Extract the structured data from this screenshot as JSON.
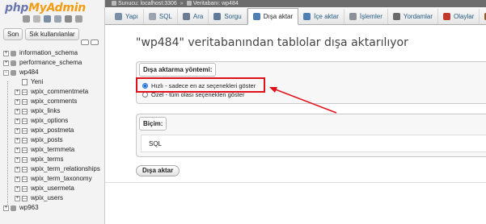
{
  "app": {
    "logo_php": "php",
    "logo_myadmin": "MyAdmin"
  },
  "sidebar": {
    "recent_button": "Son",
    "favorites_button": "Sık kullanılanlar",
    "tree": [
      {
        "type": "db",
        "label": "information_schema",
        "expander": "+"
      },
      {
        "type": "db",
        "label": "performance_schema",
        "expander": "+"
      },
      {
        "type": "db",
        "label": "wp484",
        "expander": "−"
      },
      {
        "type": "new",
        "label": "Yeni"
      },
      {
        "type": "table",
        "label": "wpix_commentmeta",
        "expander": "+"
      },
      {
        "type": "table",
        "label": "wpix_comments",
        "expander": "+"
      },
      {
        "type": "table",
        "label": "wpix_links",
        "expander": "+"
      },
      {
        "type": "table",
        "label": "wpix_options",
        "expander": "+"
      },
      {
        "type": "table",
        "label": "wpix_postmeta",
        "expander": "+"
      },
      {
        "type": "table",
        "label": "wpix_posts",
        "expander": "+"
      },
      {
        "type": "table",
        "label": "wpix_termmeta",
        "expander": "+"
      },
      {
        "type": "table",
        "label": "wpix_terms",
        "expander": "+"
      },
      {
        "type": "table",
        "label": "wpix_term_relationships",
        "expander": "+"
      },
      {
        "type": "table",
        "label": "wpix_term_taxonomy",
        "expander": "+"
      },
      {
        "type": "table",
        "label": "wpix_usermeta",
        "expander": "+"
      },
      {
        "type": "table",
        "label": "wpix_users",
        "expander": "+"
      },
      {
        "type": "db",
        "label": "wp963",
        "expander": "+"
      }
    ]
  },
  "breadcrumb": {
    "server": "Sunucu: localhost:3306",
    "separator": "»",
    "database": "Veritabanı: wp484"
  },
  "tabs": [
    {
      "name": "tab-yapi",
      "label": "Yapı",
      "color": "#7a8ea8"
    },
    {
      "name": "tab-sql",
      "label": "SQL",
      "color": "#9aa5b1"
    },
    {
      "name": "tab-ara",
      "label": "Ara",
      "color": "#6b7c93"
    },
    {
      "name": "tab-sorgu",
      "label": "Sorgu",
      "color": "#5f7a99"
    },
    {
      "name": "tab-disa-aktar",
      "label": "Dışa aktar",
      "color": "#4d7fb5",
      "active": true
    },
    {
      "name": "tab-ice-aktar",
      "label": "İçe aktar",
      "color": "#4d7fb5"
    },
    {
      "name": "tab-islemler",
      "label": "İşlemler",
      "color": "#8b9099"
    },
    {
      "name": "tab-yordamlar",
      "label": "Yordamlar",
      "color": "#6a6a6a"
    },
    {
      "name": "tab-olaylar",
      "label": "Olaylar",
      "color": "#c0392b"
    },
    {
      "name": "tab-tetikleyiciler",
      "label": "Te",
      "color": "#8b5a2b"
    }
  ],
  "main": {
    "title": "\"wp484\" veritabanından tablolar dışa aktarılıyor",
    "export_method": {
      "legend": "Dışa aktarma yöntemi:",
      "options": [
        {
          "label": "Hızlı - sadece en az seçenekleri göster",
          "selected": true
        },
        {
          "label": "Özel - tüm olası seçenekleri göster",
          "selected": false
        }
      ]
    },
    "format": {
      "legend": "Biçim:",
      "value": "SQL"
    },
    "export_button": "Dışa aktar"
  },
  "colors": {
    "annotation": "#e0101a",
    "link": "#235a81"
  }
}
